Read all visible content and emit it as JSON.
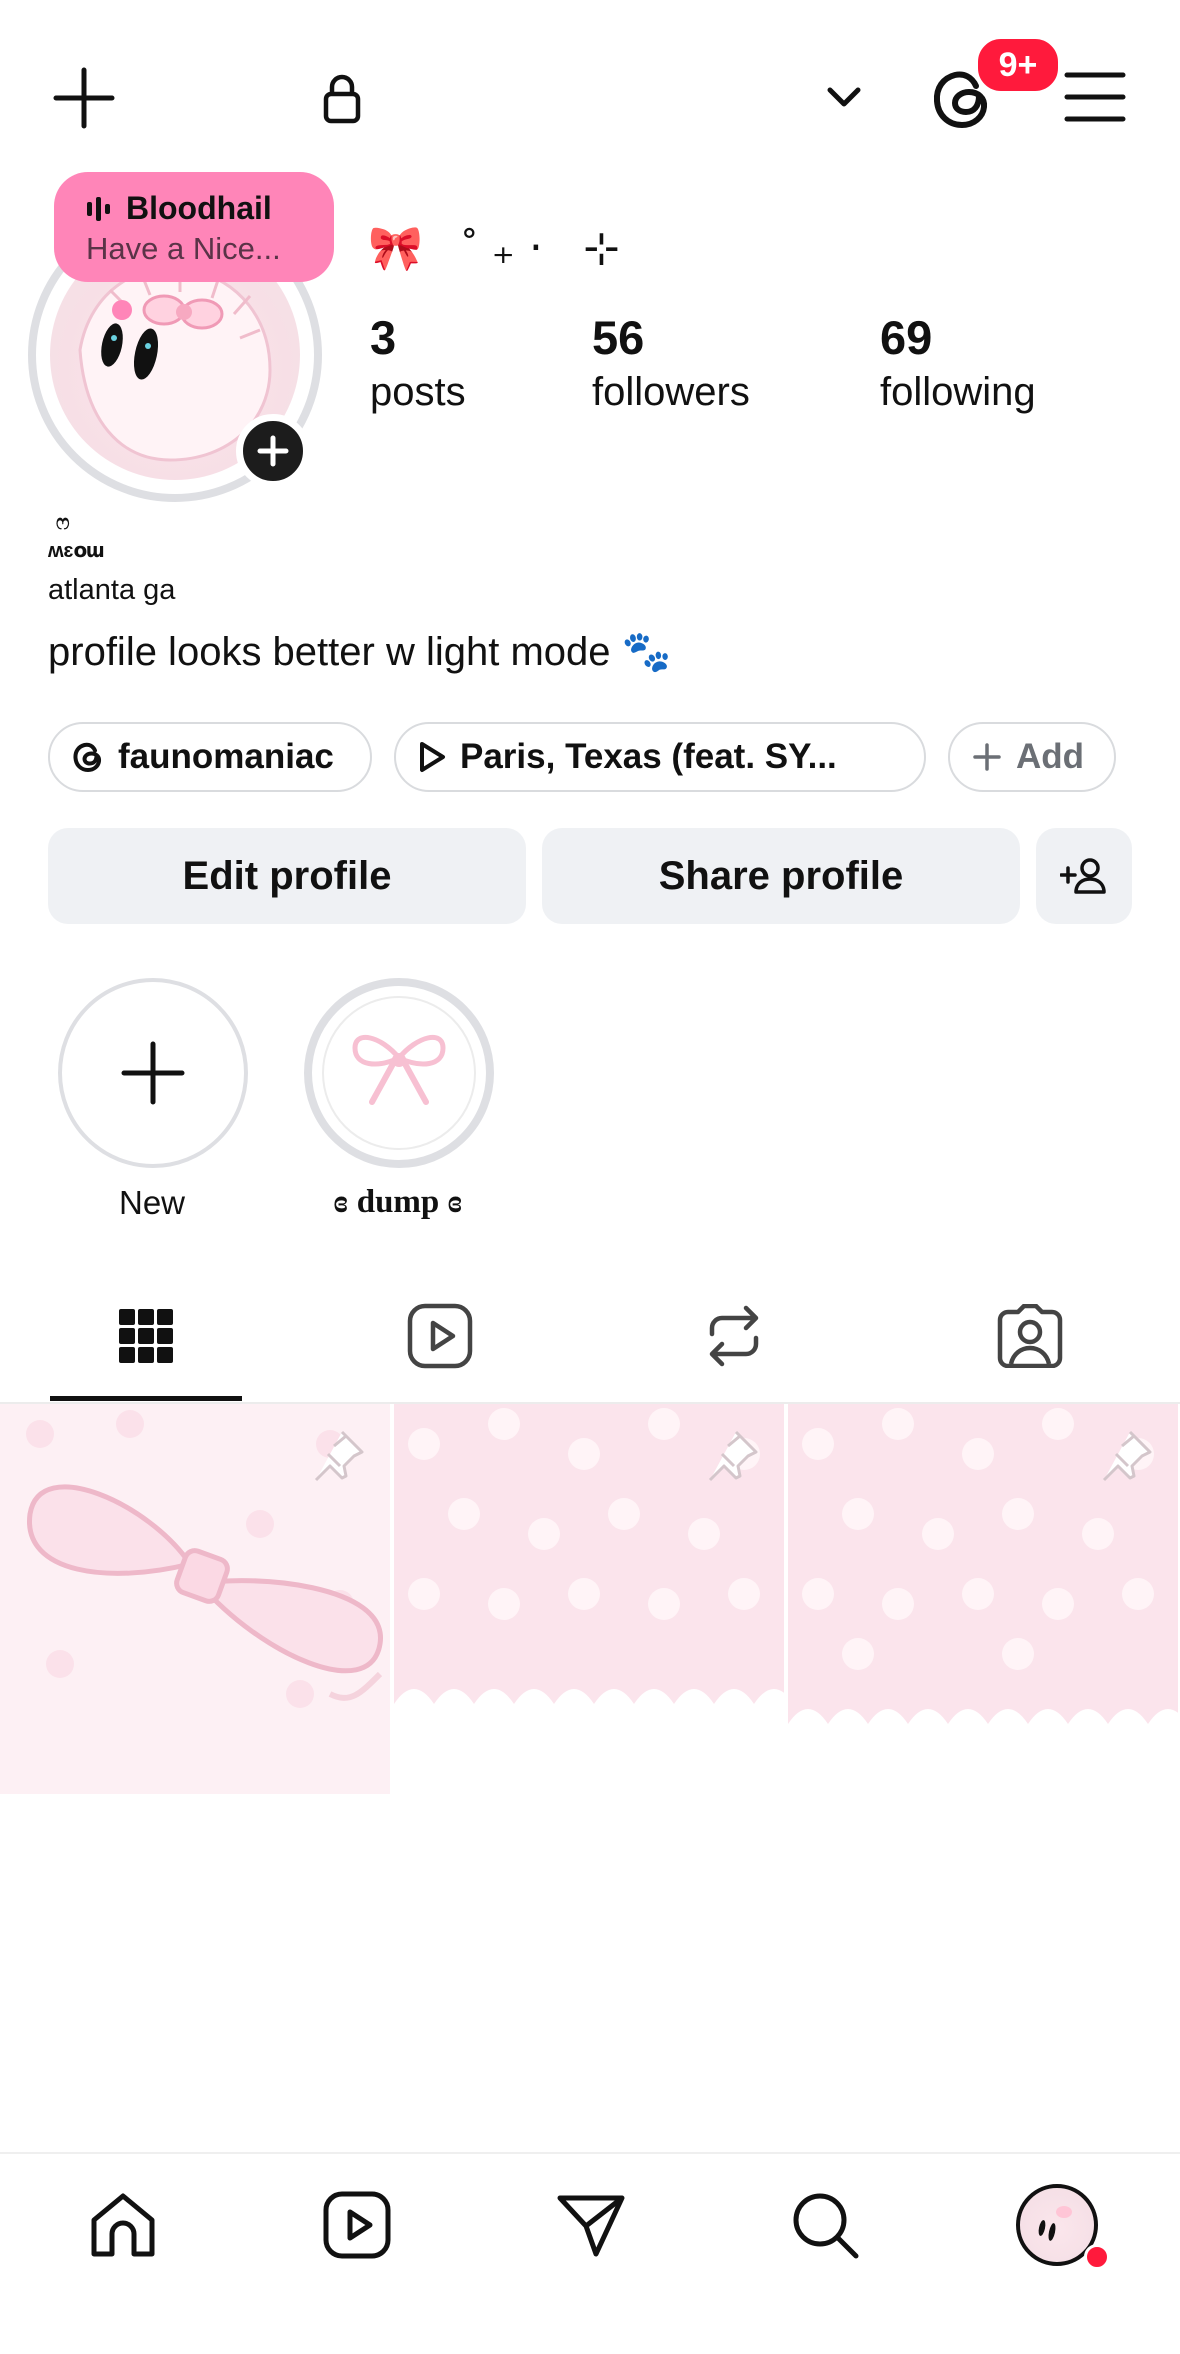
{
  "topbar": {
    "notification_badge": "9+",
    "icons": [
      "plus-icon",
      "lock-icon",
      "chevron-down-icon",
      "threads-icon",
      "hamburger-menu-icon"
    ]
  },
  "note": {
    "title": "Bloodhail",
    "subtitle": "Have a Nice..."
  },
  "profile": {
    "name_decor": "🎀 ˚₊‧ ⊹",
    "stats": [
      {
        "value": "3",
        "label": "posts"
      },
      {
        "value": "56",
        "label": "followers"
      },
      {
        "value": "69",
        "label": "following"
      }
    ],
    "tiny_heart": "ෆ",
    "tiny_name": "ʍɛօա",
    "location": "atlanta ga",
    "bio": "profile looks better w light mode 🐾"
  },
  "chips": [
    {
      "label": "faunomaniac",
      "icon": "threads-icon"
    },
    {
      "label": "Paris, Texas (feat. SY...",
      "icon": "play-icon"
    },
    {
      "label": "Add",
      "icon": "plus-icon"
    }
  ],
  "buttons": {
    "edit": "Edit profile",
    "share": "Share profile"
  },
  "highlights": [
    {
      "label": "New"
    },
    {
      "label": "ɞ dump ɞ"
    }
  ],
  "tabs": [
    "grid-icon",
    "reels-icon",
    "reposts-icon",
    "tagged-icon"
  ],
  "colors": {
    "note_bg": "#ff85b8",
    "badge": "#ff1a3c",
    "button_bg": "#eff1f4",
    "tile_pink": "#fbe4ec"
  },
  "bottom_nav": [
    "home-icon",
    "reels-icon",
    "send-icon",
    "search-icon",
    "profile-avatar"
  ]
}
